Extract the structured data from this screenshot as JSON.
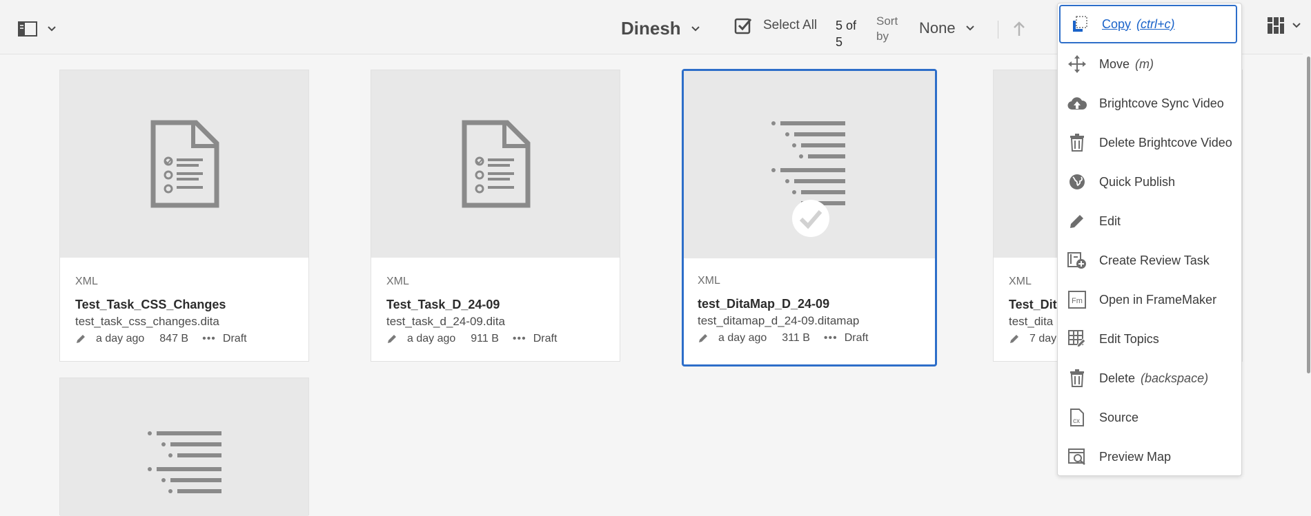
{
  "toolbar": {
    "owner": "Dinesh",
    "select_all": "Select All",
    "count": "5 of 5",
    "sort_by": "Sort by",
    "sort_value": "None"
  },
  "cards": [
    {
      "type": "XML",
      "title": "Test_Task_CSS_Changes",
      "filename": "test_task_css_changes.dita",
      "modified": "a day ago",
      "size": "847 B",
      "status": "Draft",
      "icon": "task-document-icon",
      "selected": false
    },
    {
      "type": "XML",
      "title": "Test_Task_D_24-09",
      "filename": "test_task_d_24-09.dita",
      "modified": "a day ago",
      "size": "911 B",
      "status": "Draft",
      "icon": "task-document-icon",
      "selected": false
    },
    {
      "type": "XML",
      "title": "test_DitaMap_D_24-09",
      "filename": "test_ditamap_d_24-09.ditamap",
      "modified": "a day ago",
      "size": "311 B",
      "status": "Draft",
      "icon": "ditamap-icon",
      "selected": true
    },
    {
      "type": "XML",
      "title": "Test_Dit",
      "filename": "test_dita",
      "modified": "7 day",
      "icon": "ditamap-icon",
      "selected": false
    }
  ],
  "menu": {
    "items": [
      {
        "label": "Copy",
        "shortcut": "(ctrl+c)",
        "icon": "copy-icon"
      },
      {
        "label": "Move",
        "shortcut": "(m)",
        "icon": "move-icon"
      },
      {
        "label": "Brightcove Sync Video",
        "shortcut": "",
        "icon": "cloud-upload-icon"
      },
      {
        "label": "Delete Brightcove Video",
        "shortcut": "",
        "icon": "trash-icon"
      },
      {
        "label": "Quick Publish",
        "shortcut": "",
        "icon": "globe-icon"
      },
      {
        "label": "Edit",
        "shortcut": "",
        "icon": "pencil-icon"
      },
      {
        "label": "Create Review Task",
        "shortcut": "",
        "icon": "review-task-icon"
      },
      {
        "label": "Open in FrameMaker",
        "shortcut": "",
        "icon": "framemaker-icon"
      },
      {
        "label": "Edit Topics",
        "shortcut": "",
        "icon": "edit-topics-icon"
      },
      {
        "label": "Delete",
        "shortcut": "(backspace)",
        "icon": "trash-icon"
      },
      {
        "label": "Source",
        "shortcut": "",
        "icon": "source-icon"
      },
      {
        "label": "Preview Map",
        "shortcut": "",
        "icon": "preview-map-icon"
      }
    ]
  },
  "colors": {
    "accent": "#2d6ec9",
    "icon_gray": "#8a8a8a",
    "thumb_bg": "#e8e8e8"
  }
}
